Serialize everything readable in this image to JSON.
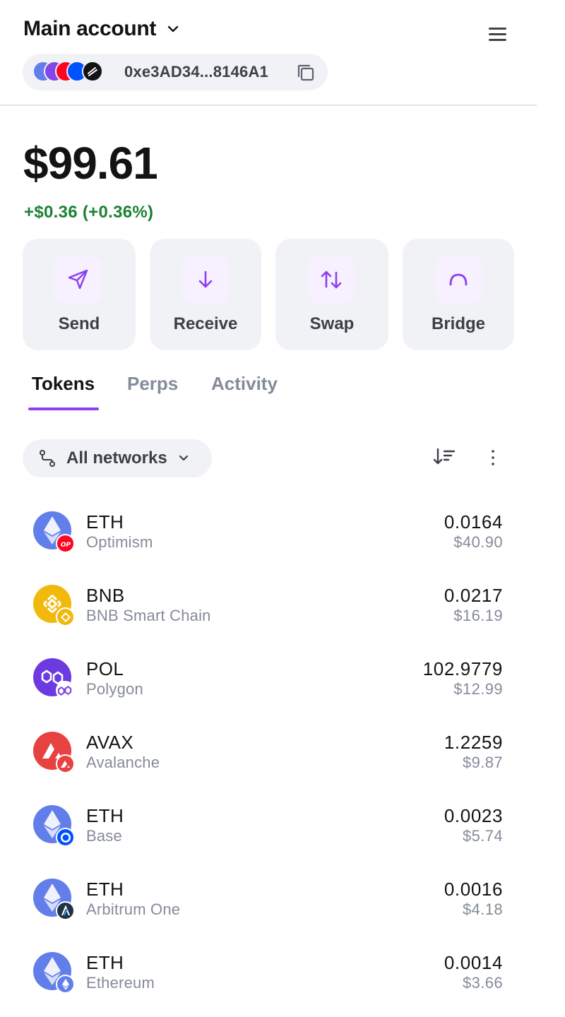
{
  "header": {
    "account_name": "Main account",
    "address": "0xe3AD34...8146A1"
  },
  "balance": {
    "total": "$99.61",
    "change": "+$0.36 (+0.36%)",
    "change_color": "#1c8234"
  },
  "actions": [
    {
      "label": "Send",
      "icon": "send-icon"
    },
    {
      "label": "Receive",
      "icon": "arrow-down-icon"
    },
    {
      "label": "Swap",
      "icon": "swap-arrows-icon"
    },
    {
      "label": "Bridge",
      "icon": "bridge-arc-icon"
    }
  ],
  "tabs": [
    {
      "label": "Tokens",
      "active": true
    },
    {
      "label": "Perps",
      "active": false
    },
    {
      "label": "Activity",
      "active": false
    }
  ],
  "filter": {
    "network_label": "All networks"
  },
  "tokens": [
    {
      "symbol": "ETH",
      "network": "Optimism",
      "amount": "0.0164",
      "usd": "$40.90",
      "token_icon": "ethereum-icon",
      "network_icon": "optimism-icon"
    },
    {
      "symbol": "BNB",
      "network": "BNB Smart Chain",
      "amount": "0.0217",
      "usd": "$16.19",
      "token_icon": "bnb-icon",
      "network_icon": "bnb-chain-icon"
    },
    {
      "symbol": "POL",
      "network": "Polygon",
      "amount": "102.9779",
      "usd": "$12.99",
      "token_icon": "polygon-icon",
      "network_icon": "polygon-chain-icon"
    },
    {
      "symbol": "AVAX",
      "network": "Avalanche",
      "amount": "1.2259",
      "usd": "$9.87",
      "token_icon": "avalanche-icon",
      "network_icon": "avalanche-chain-icon"
    },
    {
      "symbol": "ETH",
      "network": "Base",
      "amount": "0.0023",
      "usd": "$5.74",
      "token_icon": "ethereum-icon",
      "network_icon": "base-icon"
    },
    {
      "symbol": "ETH",
      "network": "Arbitrum One",
      "amount": "0.0016",
      "usd": "$4.18",
      "token_icon": "ethereum-icon",
      "network_icon": "arbitrum-icon"
    },
    {
      "symbol": "ETH",
      "network": "Ethereum",
      "amount": "0.0014",
      "usd": "$3.66",
      "token_icon": "ethereum-icon",
      "network_icon": "ethereum-chain-icon"
    }
  ],
  "colors": {
    "accent": "#8b3ff4",
    "positive": "#1c8234",
    "muted_text": "#858b9a",
    "surface": "#f1f2f5"
  }
}
